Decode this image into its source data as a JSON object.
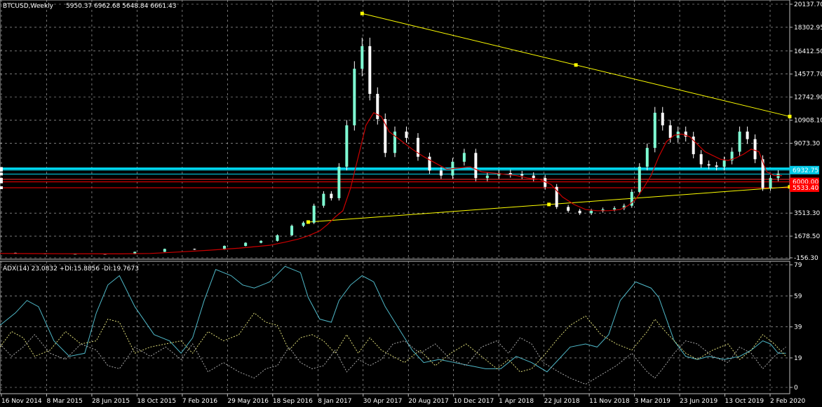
{
  "chart_data": {
    "type": "candlestick",
    "main": {
      "header": {
        "symbol": "BTCUSD,Weekly",
        "ohlc": "5950.37 6962.68 5648.84 6661.43"
      },
      "y_ticks": [
        "20137.70",
        "18302.95",
        "16412.50",
        "14577.70",
        "12742.90",
        "10908.10",
        "9073.30",
        "1678.50",
        "3513.30",
        "-156.30"
      ],
      "ylim": [
        -156.3,
        20137.7
      ],
      "price_labels": [
        {
          "text": "6932.75",
          "value": 6932.75,
          "color": "#00c8e6"
        },
        {
          "text": "6000.00",
          "value": 6000.0,
          "color": "#ff0000"
        },
        {
          "text": "5533.40",
          "value": 5533.4,
          "color": "#ff0000"
        }
      ],
      "horizontal_lines": [
        {
          "value": 7060,
          "color": "#00d8f0",
          "style": "thick"
        },
        {
          "value": 6932.75,
          "color": "#00d8f0",
          "style": "thin"
        },
        {
          "value": 6620,
          "color": "#00d8f0",
          "style": "thin"
        },
        {
          "value": 6200,
          "color": "#ff3030",
          "style": "thin"
        },
        {
          "value": 6000,
          "color": "#ff0000",
          "style": "thin"
        },
        {
          "value": 5533.4,
          "color": "#ff0000",
          "style": "thin"
        }
      ],
      "x_ticks": [
        "16 Nov 2014",
        "8 Mar 2015",
        "28 Jun 2015",
        "18 Oct 2015",
        "7 Feb 2016",
        "29 May 2016",
        "18 Sep 2016",
        "8 Jan 2017",
        "30 Apr 2017",
        "20 Aug 2017",
        "10 Dec 2017",
        "1 Apr 2018",
        "22 Jul 2018",
        "11 Nov 2018",
        "3 Mar 2019",
        "23 Jun 2019",
        "13 Oct 2019",
        "2 Feb 2020"
      ],
      "series": [
        {
          "name": "Close",
          "color": "#7fffd4",
          "x": [
            0,
            16,
            31,
            47,
            62,
            78,
            93,
            109,
            124,
            131,
            140,
            148,
            155,
            160,
            166,
            170,
            174,
            178,
            182,
            186,
            190,
            194,
            198,
            202,
            208,
            214,
            220,
            226,
            232,
            238,
            244,
            250,
            256,
            262,
            268,
            274,
            280,
            286,
            292,
            298,
            304,
            310,
            316,
            322,
            326,
            330,
            334,
            338,
            342,
            346,
            350,
            354,
            358,
            362,
            366,
            370,
            374,
            378,
            382,
            386,
            390,
            394,
            398,
            402,
            406
          ],
          "y": [
            350,
            300,
            260,
            270,
            250,
            430,
            660,
            610,
            900,
            1150,
            1300,
            1750,
            2500,
            2750,
            4100,
            5050,
            4700,
            7200,
            10500,
            15000,
            16800,
            13000,
            11000,
            8300,
            10000,
            9500,
            8000,
            6900,
            6500,
            7600,
            8300,
            6300,
            6500,
            6700,
            6600,
            6500,
            6300,
            5600,
            4000,
            3700,
            3500,
            3700,
            3800,
            3900,
            4100,
            5200,
            7200,
            8700,
            11500,
            10500,
            9500,
            10000,
            9600,
            8200,
            7400,
            7300,
            7200,
            7700,
            8400,
            10000,
            9400,
            7800,
            5500,
            6300,
            6660
          ]
        },
        {
          "name": "Moving average",
          "color": "#cc0000",
          "x": [
            0,
            16,
            31,
            47,
            62,
            78,
            93,
            109,
            124,
            131,
            140,
            148,
            155,
            160,
            166,
            170,
            174,
            178,
            182,
            186,
            190,
            194,
            198,
            202,
            208,
            214,
            220,
            226,
            232,
            238,
            244,
            250,
            256,
            262,
            268,
            274,
            280,
            286,
            292,
            298,
            304,
            310,
            316,
            322,
            326,
            330,
            334,
            338,
            342,
            346,
            350,
            354,
            358,
            362,
            366,
            370,
            374,
            378,
            382,
            386,
            390,
            394,
            398,
            402,
            406
          ],
          "y": [
            300,
            290,
            280,
            275,
            270,
            300,
            420,
            560,
            720,
            820,
            950,
            1200,
            1450,
            1700,
            2100,
            2600,
            3200,
            3700,
            5500,
            8000,
            10500,
            11500,
            11200,
            10000,
            9300,
            8600,
            8000,
            7500,
            7000,
            7100,
            7200,
            6800,
            6700,
            6600,
            6500,
            6300,
            6200,
            5800,
            4800,
            4200,
            3800,
            3700,
            3700,
            3800,
            4100,
            4600,
            5500,
            6500,
            8000,
            9200,
            9700,
            9800,
            9600,
            9000,
            8400,
            8100,
            7800,
            7700,
            7900,
            8200,
            8600,
            8400,
            6800,
            6500,
            6500
          ]
        }
      ],
      "trendlines": [
        {
          "from": [
            188,
            19400
          ],
          "to": [
            410,
            11200
          ],
          "color": "#ffff00"
        },
        {
          "from": [
            160,
            2800
          ],
          "to": [
            410,
            5600
          ],
          "color": "#ffff00"
        }
      ]
    },
    "indicator": {
      "header": "ADX(14) 23.0832 +DI:15.8856 -DI:19.7673",
      "y_ticks": [
        "79",
        "59",
        "39",
        "19",
        "0"
      ],
      "ylim": [
        0,
        79
      ],
      "series": [
        {
          "name": "ADX",
          "color": "#4fb8c8",
          "style": "solid",
          "x": [
            0,
            8,
            14,
            20,
            28,
            36,
            44,
            50,
            56,
            62,
            70,
            80,
            88,
            94,
            100,
            106,
            112,
            120,
            126,
            132,
            140,
            148,
            156,
            160,
            166,
            172,
            176,
            182,
            188,
            194,
            200,
            208,
            214,
            220,
            228,
            236,
            244,
            252,
            260,
            268,
            276,
            284,
            290,
            296,
            304,
            310,
            316,
            322,
            330,
            338,
            342,
            346,
            350,
            356,
            362,
            368,
            376,
            384,
            390,
            396,
            400,
            404,
            408
          ],
          "y": [
            40,
            48,
            56,
            52,
            30,
            20,
            22,
            48,
            66,
            72,
            52,
            34,
            30,
            22,
            32,
            56,
            76,
            72,
            66,
            64,
            68,
            78,
            74,
            58,
            44,
            42,
            56,
            66,
            72,
            68,
            52,
            36,
            24,
            16,
            18,
            16,
            14,
            12,
            12,
            20,
            16,
            10,
            18,
            26,
            28,
            26,
            34,
            56,
            68,
            64,
            58,
            44,
            30,
            20,
            18,
            20,
            18,
            20,
            24,
            30,
            28,
            22,
            22
          ]
        },
        {
          "name": "+DI",
          "color": "#dedc78",
          "style": "dashed",
          "x": [
            0,
            6,
            12,
            18,
            26,
            34,
            42,
            50,
            56,
            62,
            70,
            78,
            86,
            94,
            100,
            108,
            116,
            124,
            132,
            138,
            144,
            150,
            156,
            162,
            168,
            174,
            180,
            186,
            192,
            198,
            204,
            210,
            218,
            226,
            234,
            242,
            250,
            258,
            264,
            270,
            276,
            282,
            290,
            296,
            304,
            312,
            320,
            328,
            336,
            340,
            344,
            350,
            356,
            362,
            370,
            378,
            384,
            390,
            396,
            402,
            408
          ],
          "y": [
            26,
            36,
            32,
            20,
            24,
            36,
            28,
            30,
            44,
            42,
            22,
            26,
            28,
            30,
            22,
            36,
            30,
            34,
            48,
            42,
            40,
            24,
            32,
            34,
            30,
            22,
            34,
            22,
            32,
            24,
            20,
            16,
            24,
            14,
            22,
            28,
            20,
            12,
            18,
            10,
            12,
            20,
            32,
            40,
            46,
            34,
            28,
            24,
            36,
            44,
            38,
            30,
            22,
            18,
            24,
            28,
            18,
            24,
            34,
            28,
            20
          ]
        },
        {
          "name": "-DI",
          "color": "#a8a8a8",
          "style": "dashed",
          "x": [
            0,
            6,
            12,
            18,
            26,
            34,
            42,
            50,
            56,
            62,
            70,
            78,
            86,
            94,
            100,
            108,
            116,
            124,
            132,
            138,
            144,
            150,
            156,
            162,
            168,
            174,
            180,
            186,
            192,
            198,
            204,
            210,
            218,
            226,
            234,
            242,
            250,
            258,
            264,
            270,
            276,
            282,
            290,
            296,
            304,
            312,
            320,
            328,
            336,
            340,
            344,
            350,
            356,
            362,
            370,
            378,
            384,
            390,
            396,
            402,
            408
          ],
          "y": [
            28,
            20,
            26,
            34,
            22,
            18,
            28,
            24,
            14,
            12,
            26,
            20,
            26,
            18,
            28,
            10,
            16,
            10,
            6,
            12,
            14,
            26,
            16,
            12,
            14,
            24,
            10,
            18,
            14,
            18,
            28,
            30,
            22,
            28,
            18,
            14,
            26,
            30,
            22,
            32,
            28,
            16,
            10,
            6,
            2,
            8,
            14,
            22,
            10,
            6,
            12,
            22,
            30,
            28,
            20,
            16,
            26,
            22,
            12,
            20,
            26
          ]
        }
      ]
    }
  }
}
